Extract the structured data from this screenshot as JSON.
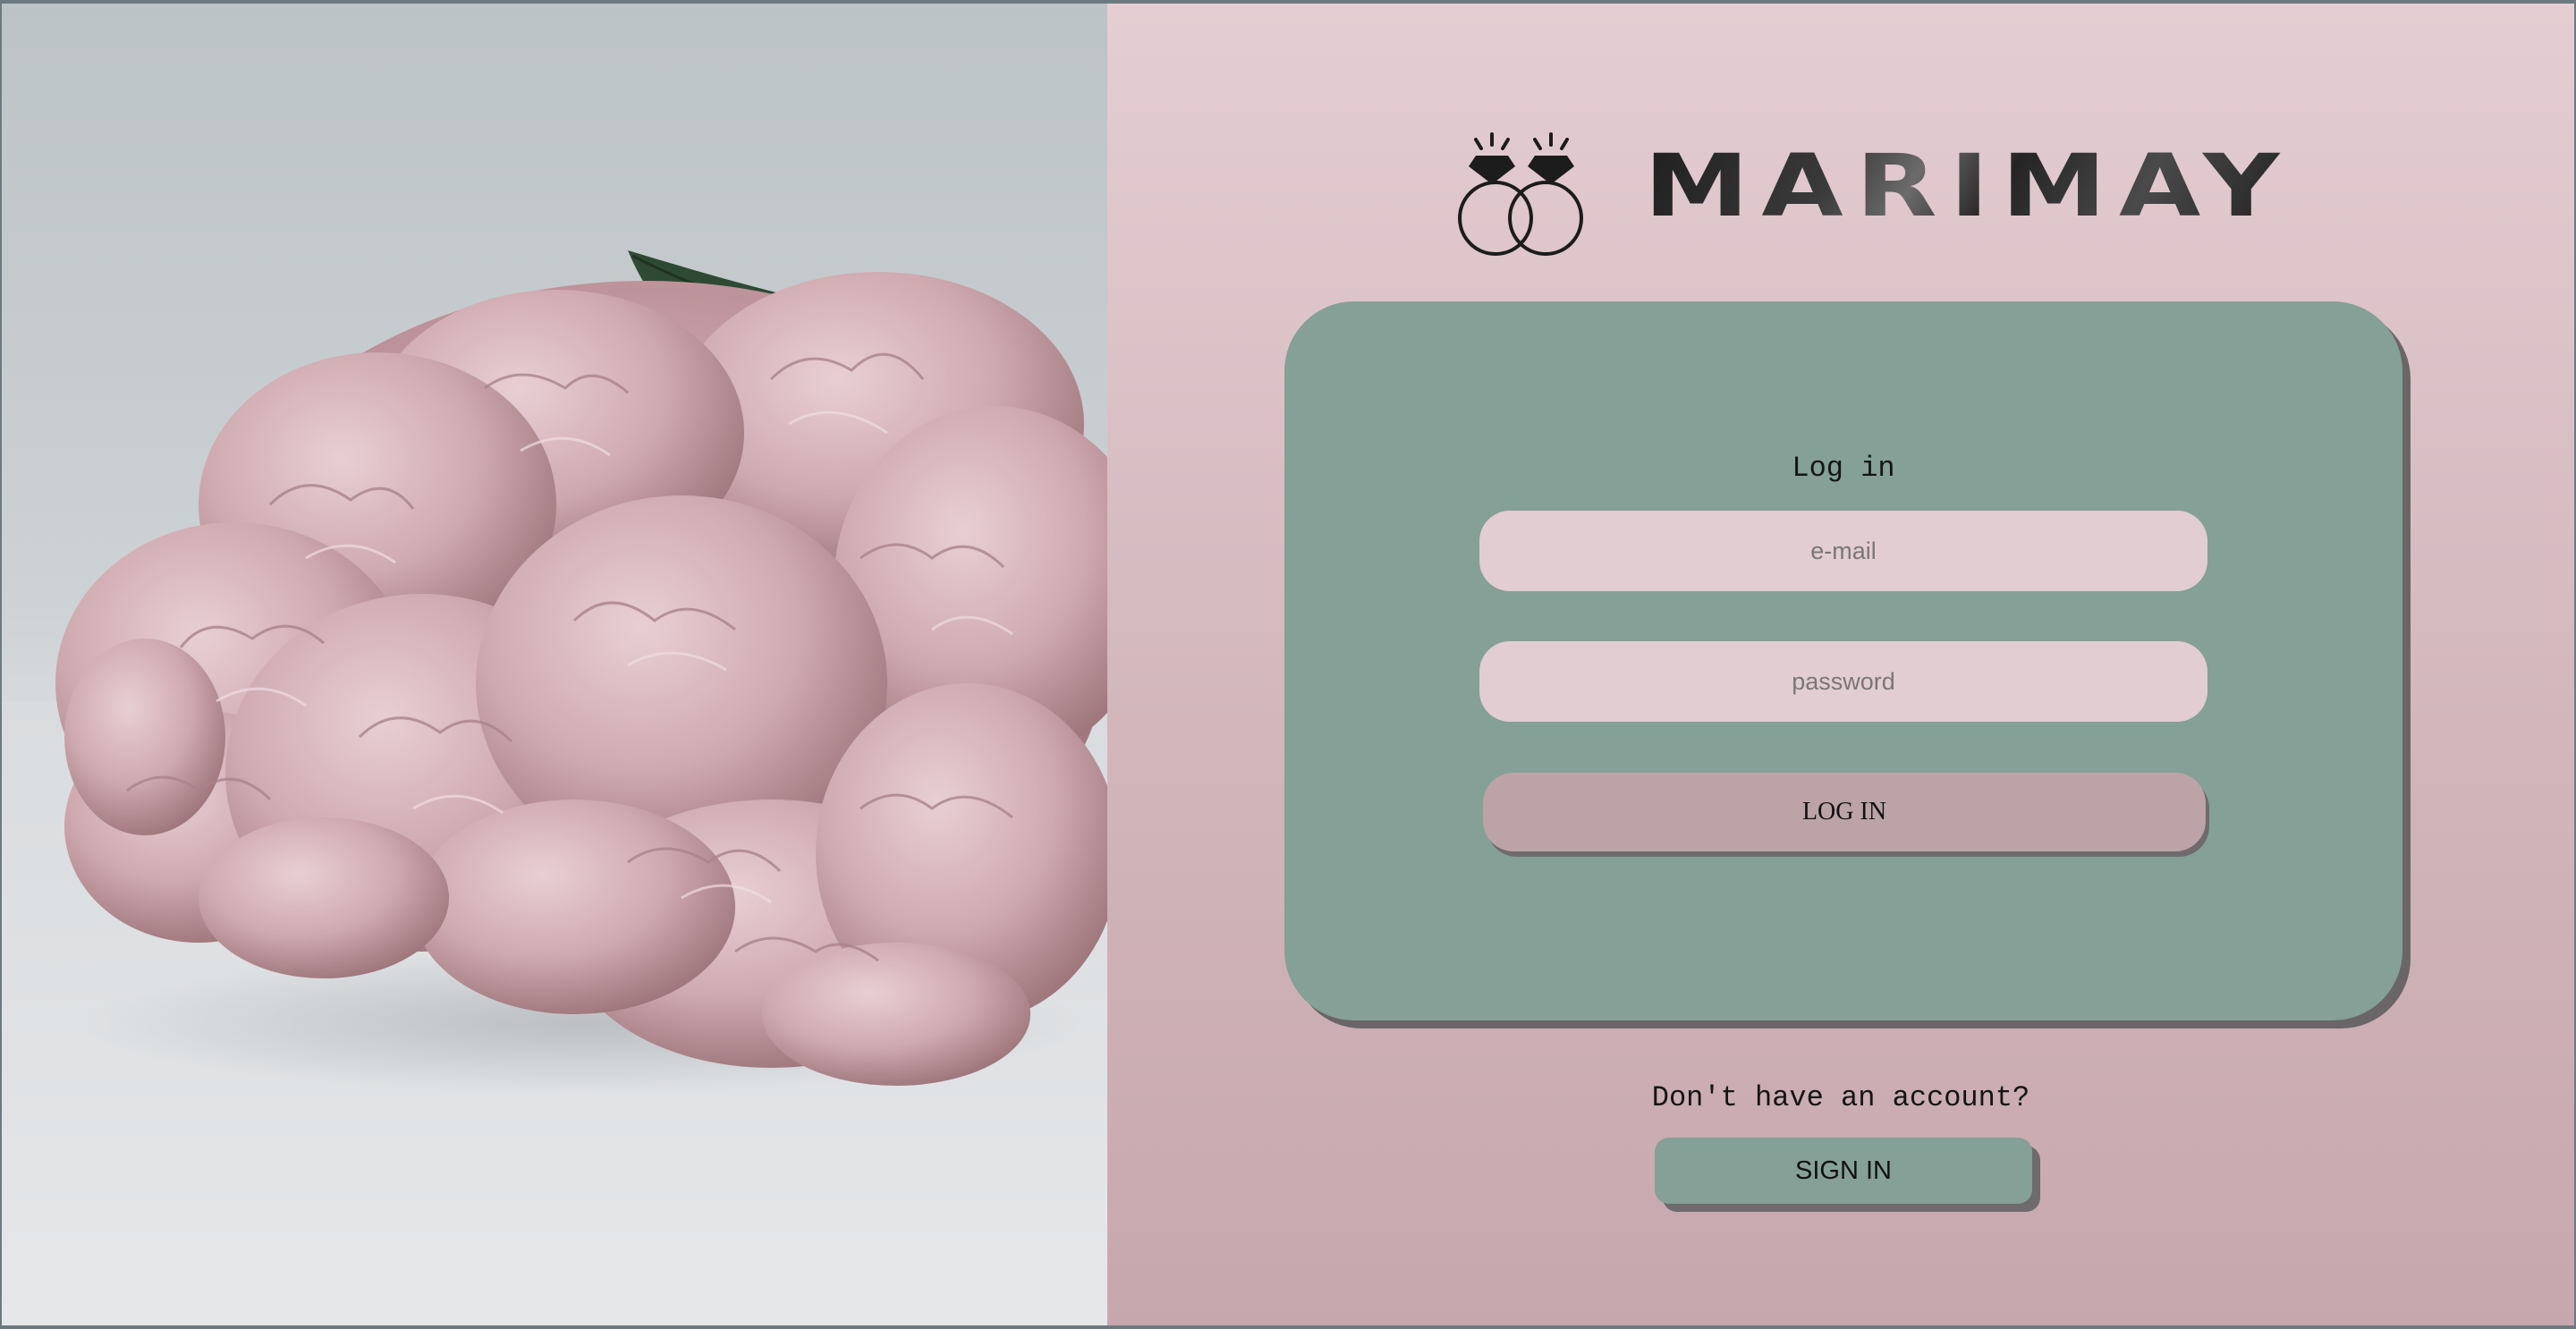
{
  "hero": {
    "image_description_icon": "hydrangea-flowers-photo"
  },
  "brand": {
    "name": "MARIMAY",
    "icon": "wedding-rings-icon"
  },
  "login": {
    "title": "Log in",
    "email_placeholder": "e-mail",
    "password_placeholder": "password",
    "submit_label": "LOG IN"
  },
  "signup": {
    "prompt": "Don't have an account?",
    "button_label": "SIGN IN"
  },
  "colors": {
    "panel_pink": "#dcc4c9",
    "card_green": "#85a096",
    "field_pink": "#e2cdd2",
    "button_mauve": "#bca3a8"
  }
}
